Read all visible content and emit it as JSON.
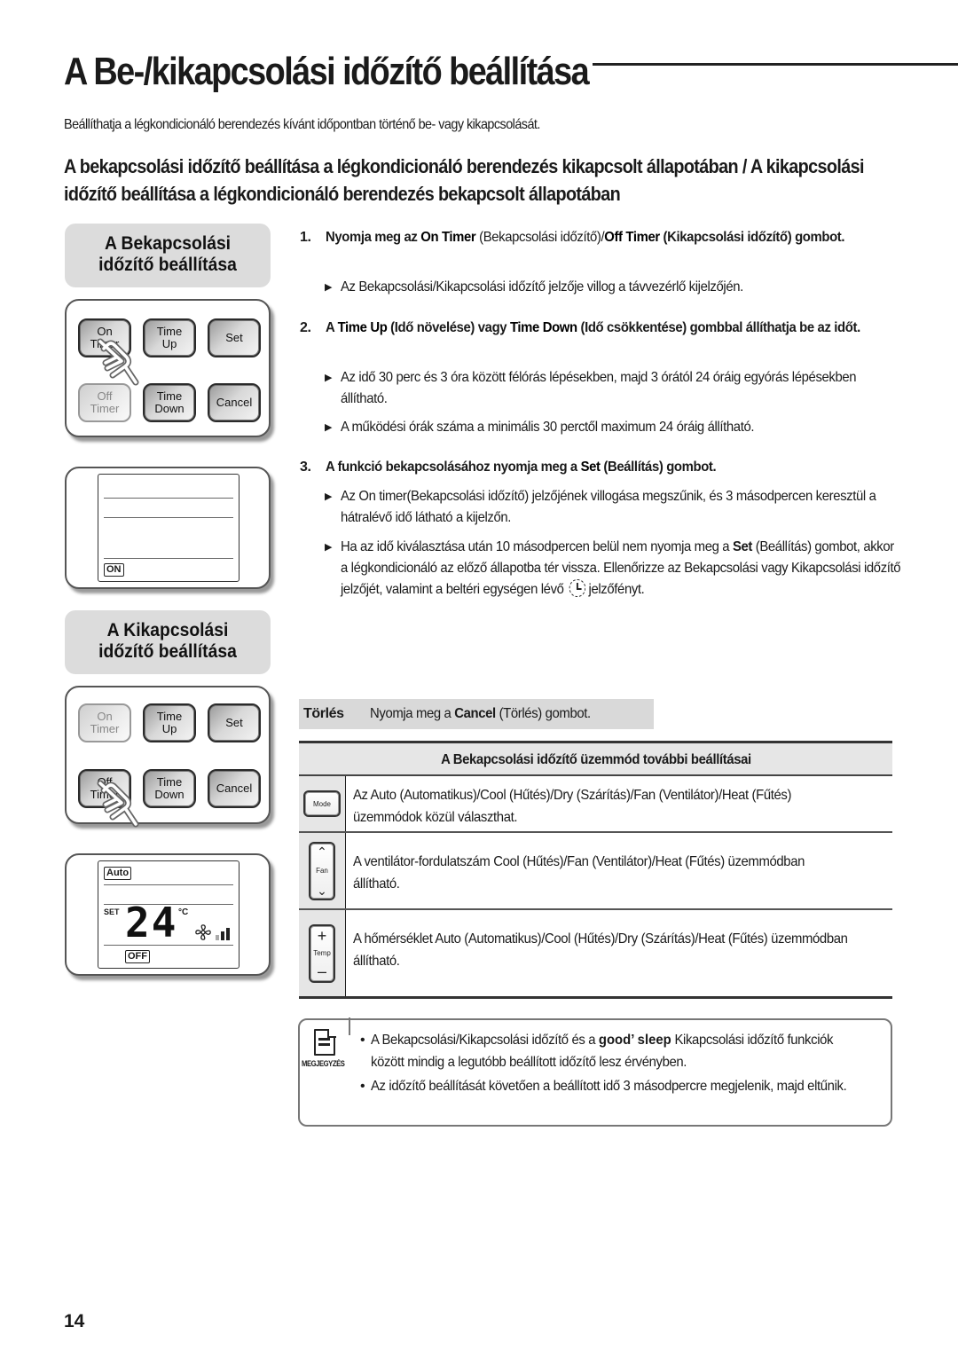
{
  "header": {
    "title": "A Be-/kikapcsolási időzítő beállítása",
    "intro": "Beállíthatja a légkondicionáló berendezés kívánt időpontban történő be- vagy kikapcsolását.",
    "subheading": "A bekapcsolási időzítő beállítása a légkondicionáló berendezés kikapcsolt állapotában / A kikapcsolási időzítő beállítása a légkondicionáló berendezés bekapcsolt állapotában"
  },
  "left": {
    "on_label": [
      "A Bekapcsolási",
      "időzítő beállítása"
    ],
    "off_label": [
      "A Kikapcsolási",
      "időzítő beállítása"
    ],
    "buttons": {
      "on_timer": [
        "On",
        "Timer"
      ],
      "time_up": [
        "Time",
        "Up"
      ],
      "set": "Set",
      "off_timer": [
        "Off",
        "Timer"
      ],
      "time_down": [
        "Time",
        "Down"
      ],
      "cancel": "Cancel"
    },
    "lcd_on": {
      "tag": "ON"
    },
    "lcd_off": {
      "mode_tag": "Auto",
      "set_label": "SET",
      "temperature": "24",
      "unit": "°C",
      "timer_tag": "OFF"
    }
  },
  "steps": [
    {
      "num": "1.",
      "parts": [
        [
          "Nyomja meg az ",
          "b"
        ],
        [
          "On Timer",
          "bb"
        ],
        [
          " (Bekapcsolási időzítő)/",
          "n"
        ],
        [
          "Off Timer",
          "bb"
        ],
        [
          " (Kikapcsolási időzítő) gombot.",
          "b"
        ]
      ]
    },
    {
      "num": "2.",
      "parts": [
        [
          "A ",
          "b"
        ],
        [
          "Time Up",
          "bb"
        ],
        [
          " (Idő növelése) vagy ",
          "b"
        ],
        [
          "Time Down",
          "bb"
        ],
        [
          " (Idő csökkentése) gombbal állíthatja be az időt.",
          "b"
        ]
      ]
    },
    {
      "num": "3.",
      "parts": [
        [
          "A funkció bekapcsolásához nyomja meg a ",
          "b"
        ],
        [
          "Set",
          "bb"
        ],
        [
          " (Beállítás) gombot.",
          "b"
        ]
      ]
    }
  ],
  "bullets": [
    "Az Bekapcsolási/Kikapcsolási időzítő jelzője villog a távvezérlő kijelzőjén.",
    "Az idő 30 perc és 3 óra között félórás lépésekben, majd 3 órától 24 óráig egyórás lépésekben állítható.",
    "A működési órák száma a minimális 30 perctől maximum 24 óráig állítható.",
    "Az On timer(Bekapcsolási időzítő) jelzőjének villogása megszűnik, és 3 másodpercen keresztül a hátralévő idő látható a kijelzőn.",
    {
      "pre": "Ha az idő kiválasztása után 10 másodpercen belül nem nyomja meg a ",
      "bold": "Set",
      "post": " (Beállítás) gombot, akkor a légkondicionáló az előző állapotba tér vissza. Ellenőrizze az Bekapcsolási vagy Kikapcsolási időzítő jelzőjét, valamint a beltéri egységen lévő",
      "tail": " jelzőfényt."
    }
  ],
  "cancel": {
    "key": "Törlés",
    "pre": "Nyomja meg a ",
    "bold": "Cancel",
    "post": " (Törlés) gombot."
  },
  "table": {
    "title": "A Bekapcsolási időzítő üzemmód további beállításai",
    "rows": [
      {
        "icon": "mode-button-icon",
        "icon_label": "Mode",
        "text": "Az Auto (Automatikus)/Cool (Hűtés)/Dry (Szárítás)/Fan (Ventilátor)/Heat (Fűtés) üzemmódok közül választhat."
      },
      {
        "icon": "fan-button-icon",
        "icon_label": "Fan",
        "text": "A ventilátor-fordulatszám Cool (Hűtés)/Fan (Ventilátor)/Heat (Fűtés) üzemmódban állítható."
      },
      {
        "icon": "temp-button-icon",
        "icon_label": "Temp",
        "text": "A hőmérséklet Auto (Automatikus)/Cool (Hűtés)/Dry (Szárítás)/Heat (Fűtés) üzemmódban állítható."
      }
    ]
  },
  "note": {
    "label": "MEGJEGYZÉS",
    "items": [
      {
        "pre": "A Bekapcsolási/Kikapcsolási időzítő és a ",
        "bold": "good’ sleep",
        "post": " Kikapcsolási időzítő funkciók között mindig a legutóbb beállított időzítő lesz érvényben."
      },
      {
        "pre": "Az időzítő beállítását követően a beállított idő 3 másodpercre megjelenik, majd eltűnik.",
        "bold": "",
        "post": ""
      }
    ]
  },
  "page_number": "14"
}
